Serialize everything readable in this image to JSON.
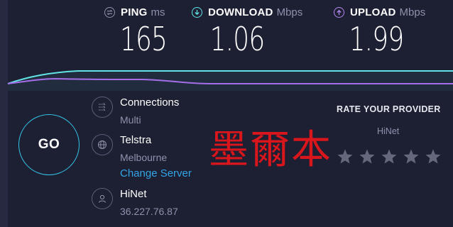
{
  "metrics": {
    "ping": {
      "label": "PING",
      "unit": "ms",
      "value": "165",
      "icon": "ping-icon",
      "color": "#8f92ad"
    },
    "download": {
      "label": "DOWNLOAD",
      "unit": "Mbps",
      "value": "1.06",
      "icon": "download-arrow-icon",
      "color": "#62e4e6"
    },
    "upload": {
      "label": "UPLOAD",
      "unit": "Mbps",
      "value": "1.99",
      "icon": "upload-arrow-icon",
      "color": "#b489ef"
    }
  },
  "graph": {
    "download_color": "#62e4e6",
    "upload_color": "#a66ee8"
  },
  "go_button": {
    "label": "GO",
    "color": "#33c5e6"
  },
  "connections": {
    "title": "Connections",
    "value": "Multi",
    "icon": "connections-icon"
  },
  "server": {
    "title": "Telstra",
    "location": "Melbourne",
    "change_label": "Change Server",
    "icon": "globe-icon"
  },
  "provider": {
    "name": "HiNet",
    "ip": "36.227.76.87",
    "icon": "user-icon"
  },
  "watermark": {
    "text": "墨爾本",
    "color": "#d8161b"
  },
  "rating": {
    "title": "RATE YOUR PROVIDER",
    "isp": "HiNet",
    "stars": 5,
    "star_color": "#65677d"
  }
}
